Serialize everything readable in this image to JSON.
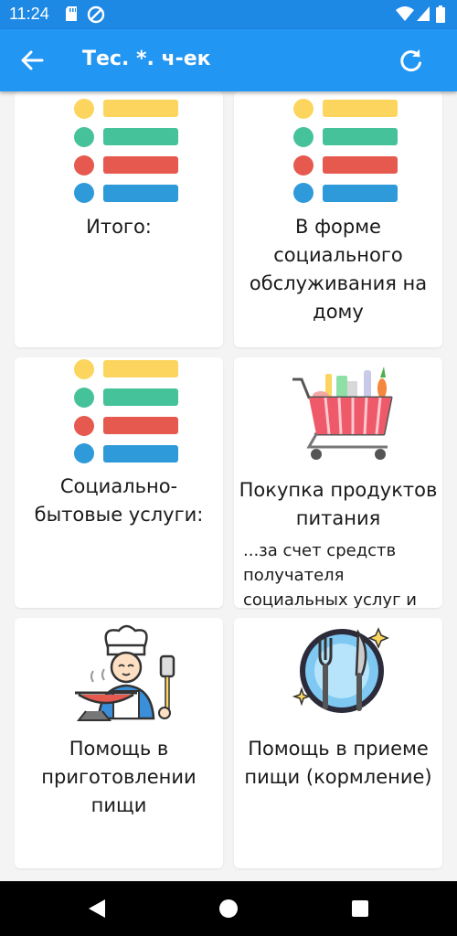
{
  "status_bar": {
    "time": "11:24"
  },
  "app_bar": {
    "title": "Тес. *. ч-ек"
  },
  "cards": [
    {
      "label": "Итого:"
    },
    {
      "label": "В форме социального обслуживания на дому"
    },
    {
      "label": "Социально-бытовые услуги:"
    },
    {
      "label": "Покупка продуктов питания",
      "sub": "...за счет средств получателя социальных услуг и"
    },
    {
      "label": "Помощь в приготовлении пищи"
    },
    {
      "label": "Помощь в приеме пищи (кормление)"
    }
  ],
  "colors": {
    "app_bar": "#2196f3",
    "status_bar": "#1e88e5",
    "yellow": "#fcd55f",
    "green": "#46c29b",
    "red": "#e6594f",
    "blue": "#2e9ad9"
  }
}
